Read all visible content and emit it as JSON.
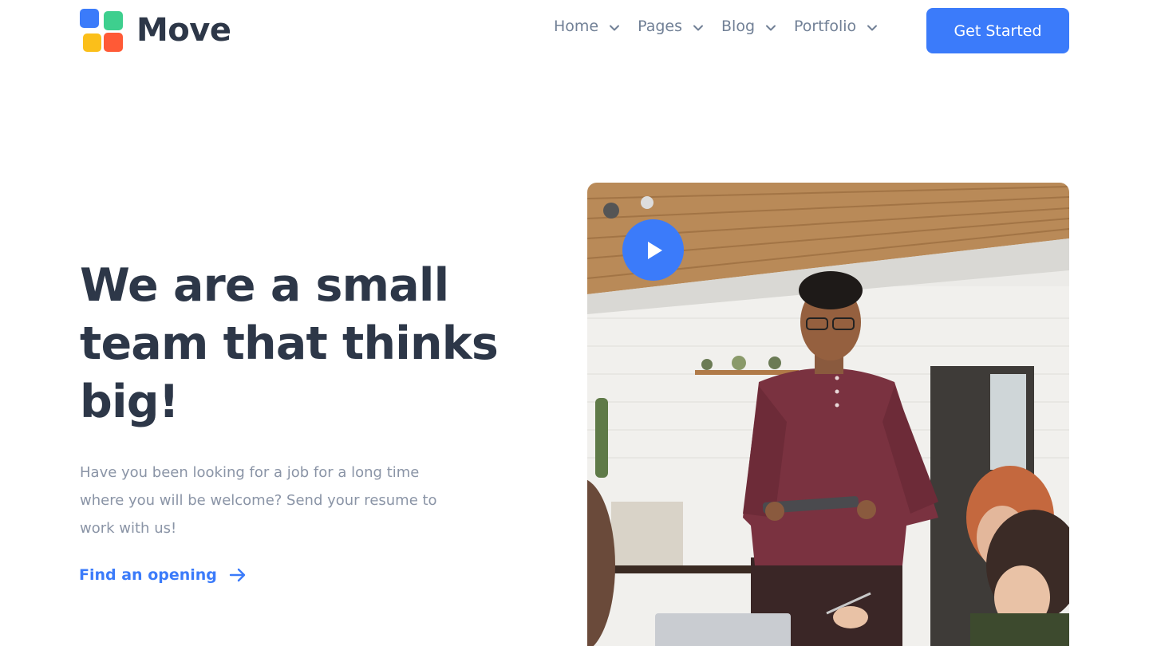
{
  "brand": {
    "name": "Move",
    "colors": {
      "blue": "#3b7bfa",
      "green": "#3ecf8e",
      "yellow": "#fbbf1a",
      "red": "#ff5a36"
    }
  },
  "nav": {
    "items": [
      {
        "label": "Home",
        "icon": "chevron-down-icon"
      },
      {
        "label": "Pages",
        "icon": "chevron-down-icon"
      },
      {
        "label": "Blog",
        "icon": "chevron-down-icon"
      },
      {
        "label": "Portfolio",
        "icon": "chevron-down-icon"
      }
    ],
    "cta_label": "Get Started"
  },
  "hero": {
    "title": "We are a small team that thinks big!",
    "description": "Have you been looking for a job for a long time where you will be welcome? Send your resume to work with us!",
    "link_label": "Find an opening",
    "link_icon": "arrow-right-icon",
    "video_icon": "play-icon"
  },
  "colors": {
    "accent": "#3b7bfa",
    "heading": "#2d3748",
    "muted": "#718096",
    "body_text": "#8a94a6"
  }
}
